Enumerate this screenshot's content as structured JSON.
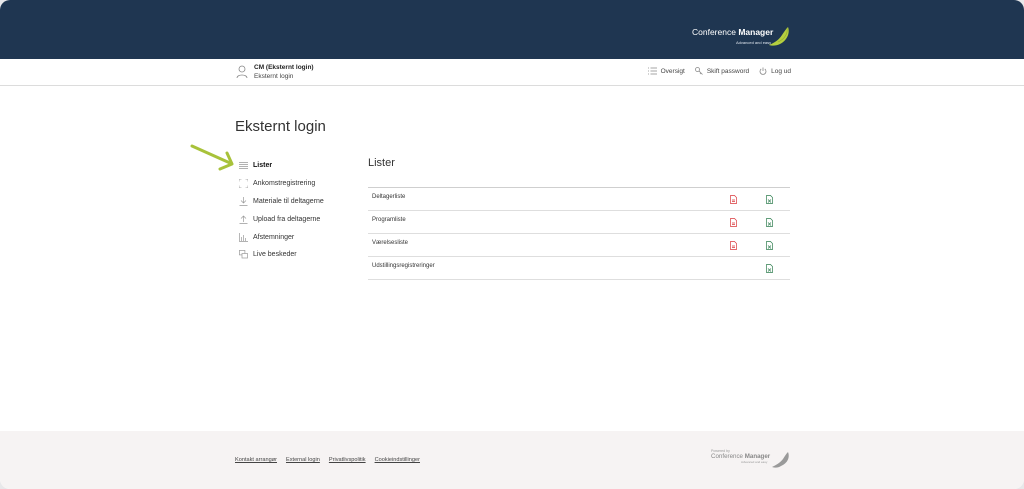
{
  "brand": {
    "name_light": "Conference",
    "name_bold": "Manager",
    "tagline": "Advanced and easy"
  },
  "user": {
    "name": "CM (Eksternt login)",
    "role": "Eksternt login"
  },
  "topnav": [
    {
      "label": "Oversigt",
      "icon": "list-icon"
    },
    {
      "label": "Skift password",
      "icon": "key-icon"
    },
    {
      "label": "Log ud",
      "icon": "power-icon"
    }
  ],
  "page_title": "Eksternt login",
  "sidebar": {
    "items": [
      {
        "label": "Lister",
        "icon": "list-icon",
        "active": true
      },
      {
        "label": "Ankomstregistrering",
        "icon": "scan-icon"
      },
      {
        "label": "Materiale til deltagerne",
        "icon": "download-icon"
      },
      {
        "label": "Upload fra deltagerne",
        "icon": "upload-icon"
      },
      {
        "label": "Afstemninger",
        "icon": "bar-chart-icon"
      },
      {
        "label": "Live beskeder",
        "icon": "chat-icon"
      }
    ]
  },
  "main": {
    "title": "Lister",
    "rows": [
      {
        "label": "Deltagerliste",
        "pdf": true,
        "excel": true
      },
      {
        "label": "Programliste",
        "pdf": true,
        "excel": true
      },
      {
        "label": "Værelsesliste",
        "pdf": true,
        "excel": true
      },
      {
        "label": "Udstillingsregistreringer",
        "pdf": false,
        "excel": true
      }
    ]
  },
  "footer": {
    "links": [
      "Kontakt arrangør",
      "External login",
      "Privatlivspolitik",
      "Cookieindstillinger"
    ],
    "powered_by": "Powered by",
    "brand_light": "Conference",
    "brand_bold": "Manager",
    "tagline": "Advanced and easy"
  },
  "colors": {
    "header": "#1f3651",
    "accent": "#a8c23a",
    "pdf": "#d9373b",
    "excel": "#2e7d4f",
    "arrow": "#a8c23a"
  }
}
